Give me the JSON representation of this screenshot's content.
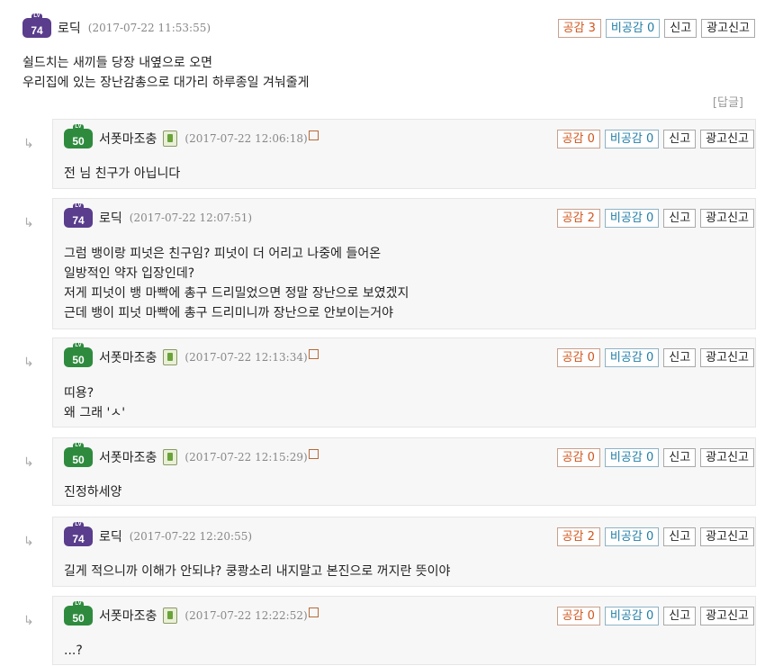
{
  "labels": {
    "like": "공감",
    "dislike": "비공감",
    "report": "신고",
    "ad_report": "광고신고",
    "reply_link": "[답글]",
    "reply_arrow": "↳",
    "delete_mark": "☒"
  },
  "root": {
    "level": "74",
    "nick": "로딕",
    "date": "(2017-07-22 11:53:55)",
    "likes": "3",
    "dislikes": "0",
    "body": "쉴드치는 새끼들 당장 내옆으로 오면\n우리집에 있는 장난감총으로 대가리 하루종일 겨눠줄게"
  },
  "replies": [
    {
      "level": "50",
      "nick": "서폿마조충",
      "date": "(2017-07-22 12:06:18)",
      "likes": "0",
      "dislikes": "0",
      "body": "전 님 친구가 아닙니다"
    },
    {
      "level": "74",
      "nick": "로딕",
      "date": "(2017-07-22 12:07:51)",
      "likes": "2",
      "dislikes": "0",
      "body": "그럼 뱅이랑 피넛은 친구임? 피넛이 더 어리고 나중에 들어온\n일방적인 약자 입장인데?\n저게 피넛이 뱅 마빡에 총구 드리밀었으면 정말 장난으로 보였겠지\n근데 뱅이 피넛 마빡에 총구 드리미니까 장난으로 안보이는거야"
    },
    {
      "level": "50",
      "nick": "서폿마조충",
      "date": "(2017-07-22 12:13:34)",
      "likes": "0",
      "dislikes": "0",
      "body": "띠용?\n왜 그래 'ㅅ'"
    },
    {
      "level": "50",
      "nick": "서폿마조충",
      "date": "(2017-07-22 12:15:29)",
      "likes": "0",
      "dislikes": "0",
      "body": "진정하세양"
    },
    {
      "level": "74",
      "nick": "로딕",
      "date": "(2017-07-22 12:20:55)",
      "likes": "2",
      "dislikes": "0",
      "body": "길게 적으니까 이해가 안되냐? 쿵쾅소리 내지말고 본진으로 꺼지란 뜻이야"
    },
    {
      "level": "50",
      "nick": "서폿마조충",
      "date": "(2017-07-22 12:22:52)",
      "likes": "0",
      "dislikes": "0",
      "body": "...?"
    }
  ]
}
